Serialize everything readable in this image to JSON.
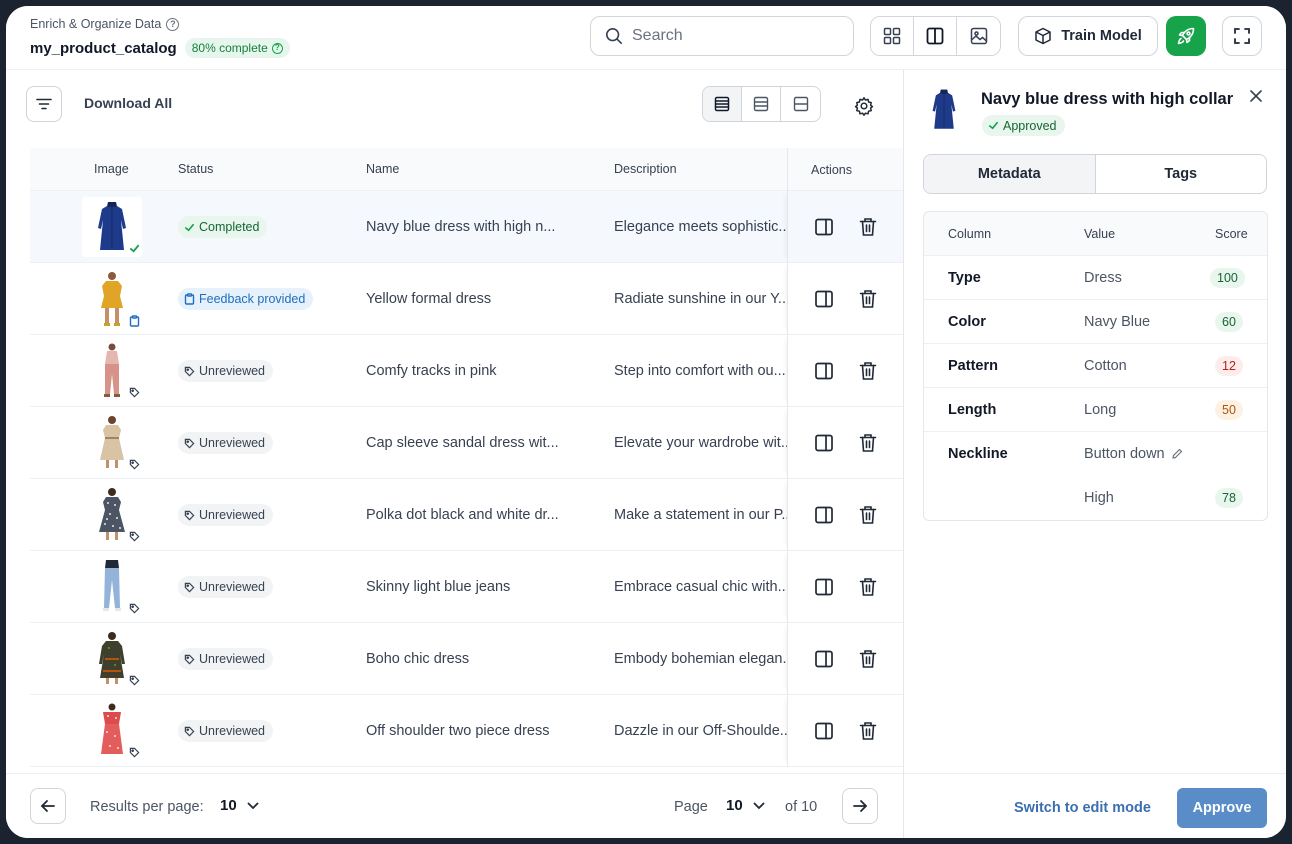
{
  "header": {
    "breadcrumb": "Enrich & Organize Data",
    "catalog_name": "my_product_catalog",
    "progress": "80% complete",
    "search_placeholder": "Search",
    "train_label": "Train Model"
  },
  "toolbar": {
    "download_all": "Download All"
  },
  "table": {
    "columns": {
      "image": "Image",
      "status": "Status",
      "name": "Name",
      "description": "Description",
      "actions": "Actions"
    },
    "rows": [
      {
        "status": "Completed",
        "name": "Navy blue dress with high n...",
        "description": "Elegance meets sophistic..."
      },
      {
        "status": "Feedback provided",
        "name": "Yellow formal dress",
        "description": "Radiate sunshine in our Y..."
      },
      {
        "status": "Unreviewed",
        "name": "Comfy tracks in pink",
        "description": "Step into comfort with ou..."
      },
      {
        "status": "Unreviewed",
        "name": "Cap sleeve sandal dress wit...",
        "description": "Elevate your wardrobe wit..."
      },
      {
        "status": "Unreviewed",
        "name": "Polka dot black and white dr...",
        "description": "Make a statement in our P..."
      },
      {
        "status": "Unreviewed",
        "name": "Skinny light blue jeans",
        "description": "Embrace casual chic with..."
      },
      {
        "status": "Unreviewed",
        "name": "Boho chic dress",
        "description": "Embody bohemian elegan..."
      },
      {
        "status": "Unreviewed",
        "name": "Off shoulder two piece dress",
        "description": "Dazzle in our Off-Shoulde..."
      }
    ]
  },
  "pagination": {
    "results_label": "Results per page:",
    "results_value": "10",
    "page_label": "Page",
    "page_value": "10",
    "of_label": "of 10"
  },
  "panel": {
    "title": "Navy blue dress with high collar",
    "status": "Approved",
    "tabs": [
      "Metadata",
      "Tags"
    ],
    "columns": {
      "column": "Column",
      "value": "Value",
      "score": "Score"
    },
    "rows": [
      {
        "column": "Type",
        "value": "Dress",
        "score": "100"
      },
      {
        "column": "Color",
        "value": "Navy Blue",
        "score": "60"
      },
      {
        "column": "Pattern",
        "value": "Cotton",
        "score": "12"
      },
      {
        "column": "Length",
        "value": "Long",
        "score": "50"
      },
      {
        "column": "Neckline",
        "value": "Button down",
        "score": ""
      },
      {
        "column": "",
        "value": "High",
        "score": "78"
      }
    ],
    "switch_label": "Switch to edit mode",
    "approve_label": "Approve"
  },
  "colors": {
    "brand_green": "#16a34a",
    "approve_blue": "#5a8cc8",
    "link_blue": "#3b6fb0"
  }
}
